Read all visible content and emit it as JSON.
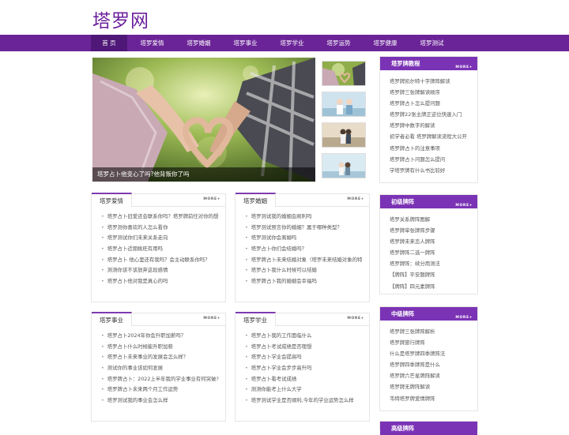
{
  "site": {
    "logo": "塔罗网"
  },
  "nav": [
    {
      "label": "首 页"
    },
    {
      "label": "塔罗爱情"
    },
    {
      "label": "塔罗婚姻"
    },
    {
      "label": "塔罗事业"
    },
    {
      "label": "塔罗学业"
    },
    {
      "label": "塔罗运势"
    },
    {
      "label": "塔罗健康"
    },
    {
      "label": "塔罗测试"
    }
  ],
  "hero": {
    "caption": "塔罗占卜他变心了吗?他背叛你了吗"
  },
  "more_label": "MORE+",
  "sections": {
    "love": {
      "title": "塔罗爱情",
      "items": [
        "塔罗占卜旧爱还会联系你吗？塔罗牌前任对你的想法",
        "塔罗测你喜欢的人怎么看你",
        "塔罗测试你们未来关系走向",
        "塔罗占卜近期桃旺有用吗",
        "塔罗占卜 他心里还有我吗？会主动联系你吗？",
        "测测你该不该放弃这段感情",
        "塔罗占卜他对我是真心的吗"
      ]
    },
    "marriage": {
      "title": "塔罗婚姻",
      "items": [
        "塔罗测试我的婚姻会顺利吗",
        "塔罗测试预言你的婚姻？属于哪种类型？",
        "塔罗测试你会离婚吗",
        "塔罗占卜你们会结婚吗？",
        "塔罗牌占卜未来结婚对象（塔罗未来结婚对象的特...",
        "塔罗占卜我什么时候可以结婚",
        "塔罗牌占卜我的婚姻会幸福吗"
      ]
    },
    "career": {
      "title": "塔罗事业",
      "items": [
        "塔罗占卜2024年你会升职加薪吗？",
        "塔罗占卜什么时候能升职加薪",
        "塔罗占卜未来事业的发展会怎么样？",
        "测试你的事业该如何发展",
        "塔罗牌占卜：2022上半年我的学业事业有何突破?",
        "塔罗牌占卜未来两个月工作运势",
        "塔罗测试我的事业会怎么样"
      ]
    },
    "study": {
      "title": "塔罗学业",
      "items": [
        "塔罗占卜我的工作面临什么",
        "塔罗占卜考试成绩是否理想",
        "塔罗占卜学业会提高吗",
        "塔罗占卜学业会步步高升吗",
        "塔罗占卜看考试成绩",
        "测测你能考上什么大学",
        "塔罗测试学业是否顺利,今年的学业运势怎么样"
      ]
    }
  },
  "sidebar": [
    {
      "title": "塔罗牌教程",
      "items": [
        "塔罗牌凯尔特十字牌阵解读",
        "塔罗牌三张牌解读顺序",
        "塔罗牌占卜怎么提问题",
        "塔罗牌22张主牌正逆位快速入门",
        "塔罗牌中数字的解读",
        "初学者必看 塔罗牌解读流程大公开",
        "塔罗牌占卜的注意事项",
        "塔罗牌占卜问题怎么提问",
        "学塔罗牌有什么书比较好"
      ]
    },
    {
      "title": "初级牌阵",
      "items": [
        "塔罗关系牌阵图解",
        "塔罗牌单张牌阵步骤",
        "塔罗牌未来恋人牌阵",
        "塔罗牌阵二选一牌阵",
        "塔罗牌阵：续分用测法",
        "【牌阵】平安题牌阵",
        "【牌阵】四元素牌阵"
      ]
    },
    {
      "title": "中级牌阵",
      "items": [
        "塔罗牌三张牌阵解析",
        "塔罗牌旅行牌阵",
        "什么是塔罗牌四季牌阵法",
        "塔罗牌四季牌阵是什么",
        "塔罗牌六芒星牌阵解读",
        "塔罗牌无牌阵解读",
        "韦特塔罗牌爱情牌阵"
      ]
    },
    {
      "title": "高级牌阵",
      "items": []
    }
  ]
}
